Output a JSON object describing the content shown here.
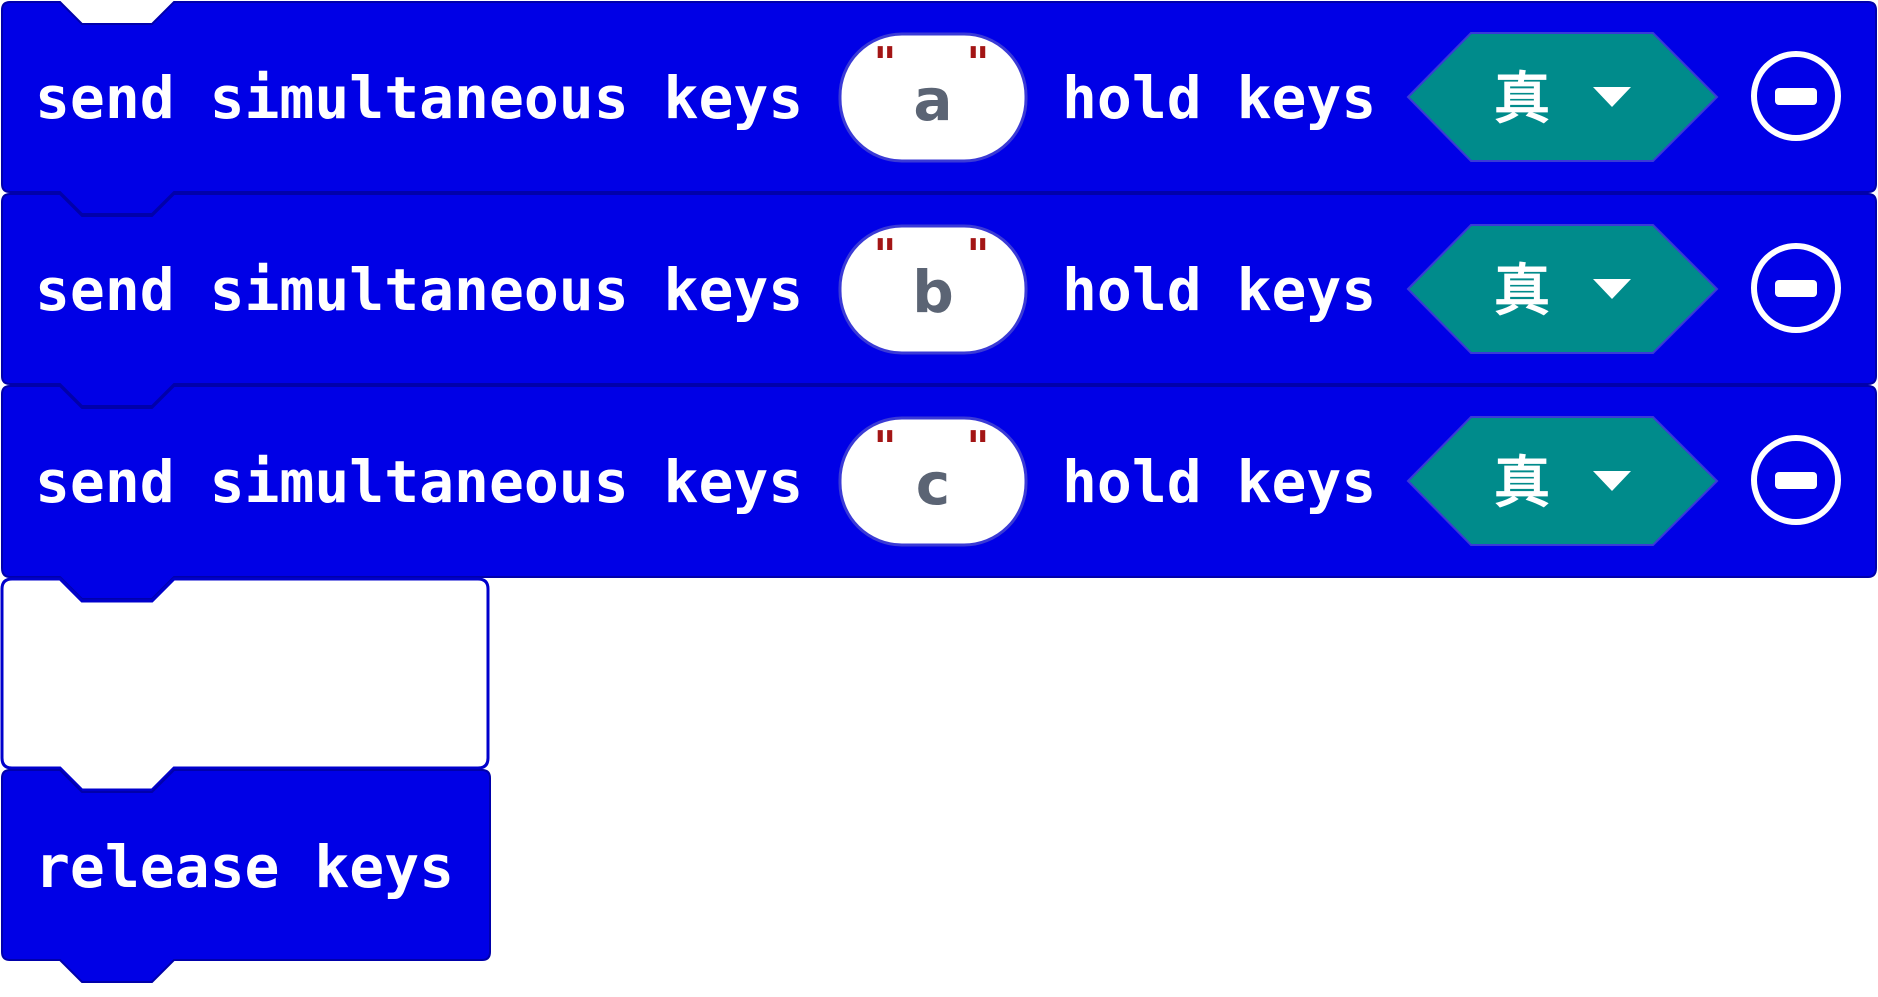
{
  "colors": {
    "block": "#0000e6",
    "block_border": "#0000aa",
    "bool_dropdown": "#008b8b",
    "empty_slot_border": "#0000cc",
    "quote": "#a31515",
    "string_text": "#5b6474"
  },
  "blocks": [
    {
      "label": "send simultaneous keys",
      "key_value": "a",
      "hold_label": "hold keys",
      "hold_value": "真",
      "remove_icon": "minus-circle-icon"
    },
    {
      "label": "send simultaneous keys",
      "key_value": "b",
      "hold_label": "hold keys",
      "hold_value": "真",
      "remove_icon": "minus-circle-icon"
    },
    {
      "label": "send simultaneous keys",
      "key_value": "c",
      "hold_label": "hold keys",
      "hold_value": "真",
      "remove_icon": "minus-circle-icon"
    }
  ],
  "quote_mark": "\"",
  "release_block": {
    "label": "release keys"
  }
}
